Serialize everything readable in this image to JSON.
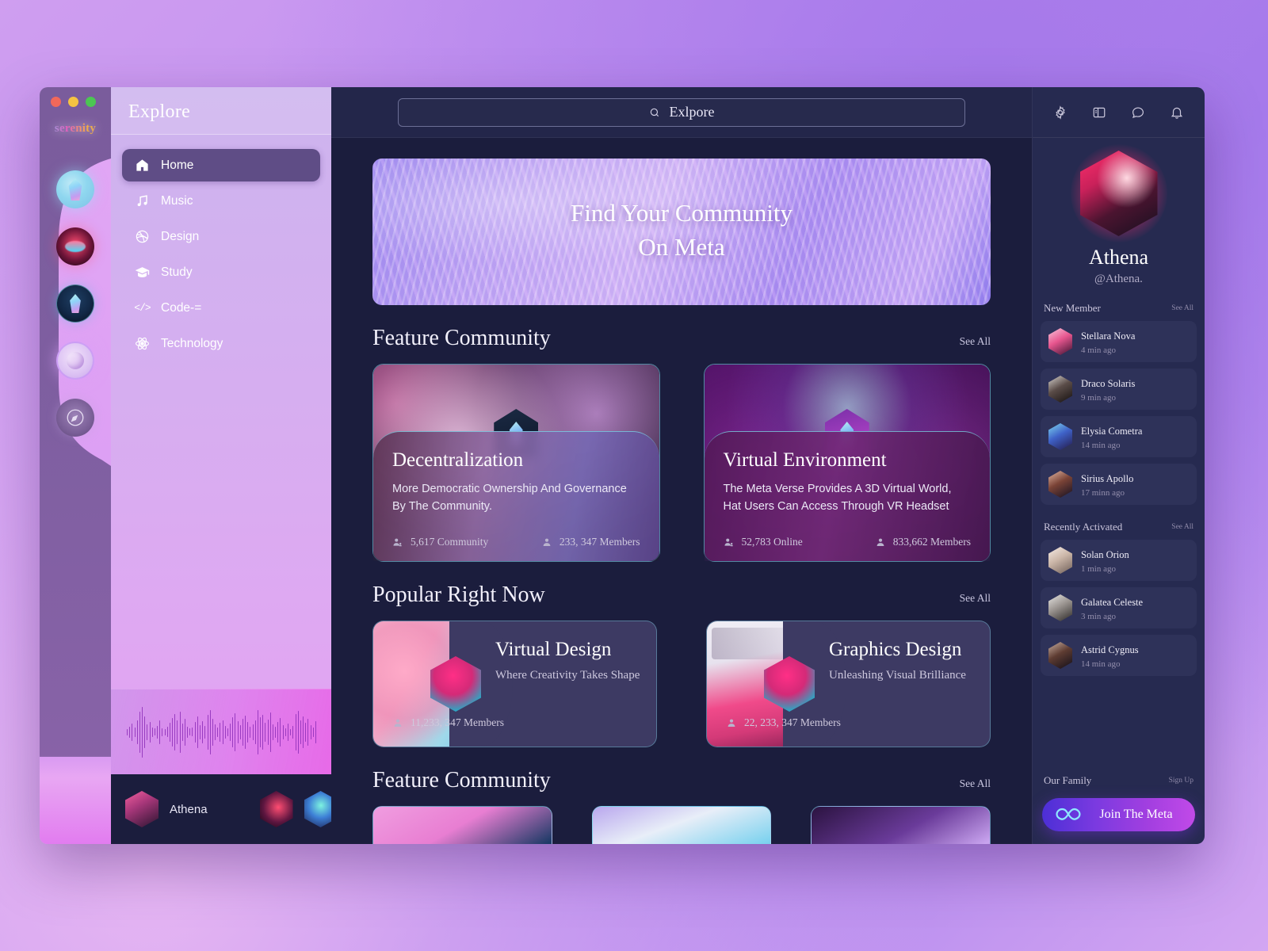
{
  "window": {
    "brand": "serenity",
    "traffic_lights": [
      "close",
      "minimize",
      "maximize"
    ]
  },
  "nav": {
    "title": "Explore",
    "items": [
      {
        "label": "Home",
        "icon": "home-icon",
        "active": true
      },
      {
        "label": "Music",
        "icon": "music-icon",
        "active": false
      },
      {
        "label": "Design",
        "icon": "dribbble-icon",
        "active": false
      },
      {
        "label": "Study",
        "icon": "graduation-cap-icon",
        "active": false
      },
      {
        "label": "Code-=",
        "icon": "code-icon",
        "active": false
      },
      {
        "label": "Technology",
        "icon": "atom-icon",
        "active": false
      }
    ]
  },
  "dock": {
    "user": "Athena",
    "avatars": [
      "athena-avatar",
      "avatar-a",
      "avatar-b",
      "avatar-c"
    ]
  },
  "search": {
    "value": "Exlpore",
    "icon": "search-icon"
  },
  "header_icons": [
    {
      "name": "gear-icon"
    },
    {
      "name": "layout-panel-icon"
    },
    {
      "name": "chat-bubble-icon"
    },
    {
      "name": "bell-icon"
    }
  ],
  "hero": {
    "line1": "Find Your Community",
    "line2": "On Meta"
  },
  "sections": {
    "feature_community": {
      "title": "Feature Community",
      "see_all": "See All",
      "cards": [
        {
          "title": "Decentralization",
          "description": "More Democratic Ownership And Governance By The Community.",
          "stat_left": "5,617 Community",
          "stat_right": "233, 347 Members"
        },
        {
          "title": "Virtual Environment",
          "description": "The Meta Verse Provides A 3D Virtual World, Hat Users Can Access Through VR Headset",
          "stat_left": "52,783 Online",
          "stat_right": "833,662 Members"
        }
      ]
    },
    "popular_right_now": {
      "title": "Popular Right Now",
      "see_all": "See All",
      "cards": [
        {
          "title": "Virtual Design",
          "subtitle": "Where Creativity Takes Shape",
          "members": "11,233, 347 Members"
        },
        {
          "title": "Graphics Design",
          "subtitle": "Unleashing Visual Brilliance",
          "members": "22, 233, 347 Members"
        }
      ]
    },
    "feature_community_bottom": {
      "title": "Feature Community",
      "see_all": "See All"
    }
  },
  "profile": {
    "name": "Athena",
    "handle": "@Athena."
  },
  "new_member": {
    "title": "New Member",
    "see_all": "See All",
    "members": [
      {
        "name": "Stellara Nova",
        "time": "4 min ago"
      },
      {
        "name": "Draco Solaris",
        "time": "9 min ago"
      },
      {
        "name": "Elysia Cometra",
        "time": "14 min ago"
      },
      {
        "name": "Sirius Apollo",
        "time": "17 minn ago"
      }
    ]
  },
  "recently_activated": {
    "title": "Recently Activated",
    "see_all": "See All",
    "members": [
      {
        "name": "Solan Orion",
        "time": "1 min ago"
      },
      {
        "name": "Galatea Celeste",
        "time": "3  min ago"
      },
      {
        "name": "Astrid Cygnus",
        "time": "14 min ago"
      }
    ]
  },
  "our_family": {
    "title": "Our Family",
    "sign_up": "Sign Up",
    "join_button": "Join The Meta"
  },
  "colors": {
    "app_background": "#1b1d3d",
    "panel_background": "#262a50",
    "row_background": "#2e3259",
    "nav_active": "#5f4d86",
    "accent_purple": "#a33fe0",
    "desktop_gradient_start": "#cf9ef0",
    "desktop_gradient_end": "#a47bec"
  }
}
